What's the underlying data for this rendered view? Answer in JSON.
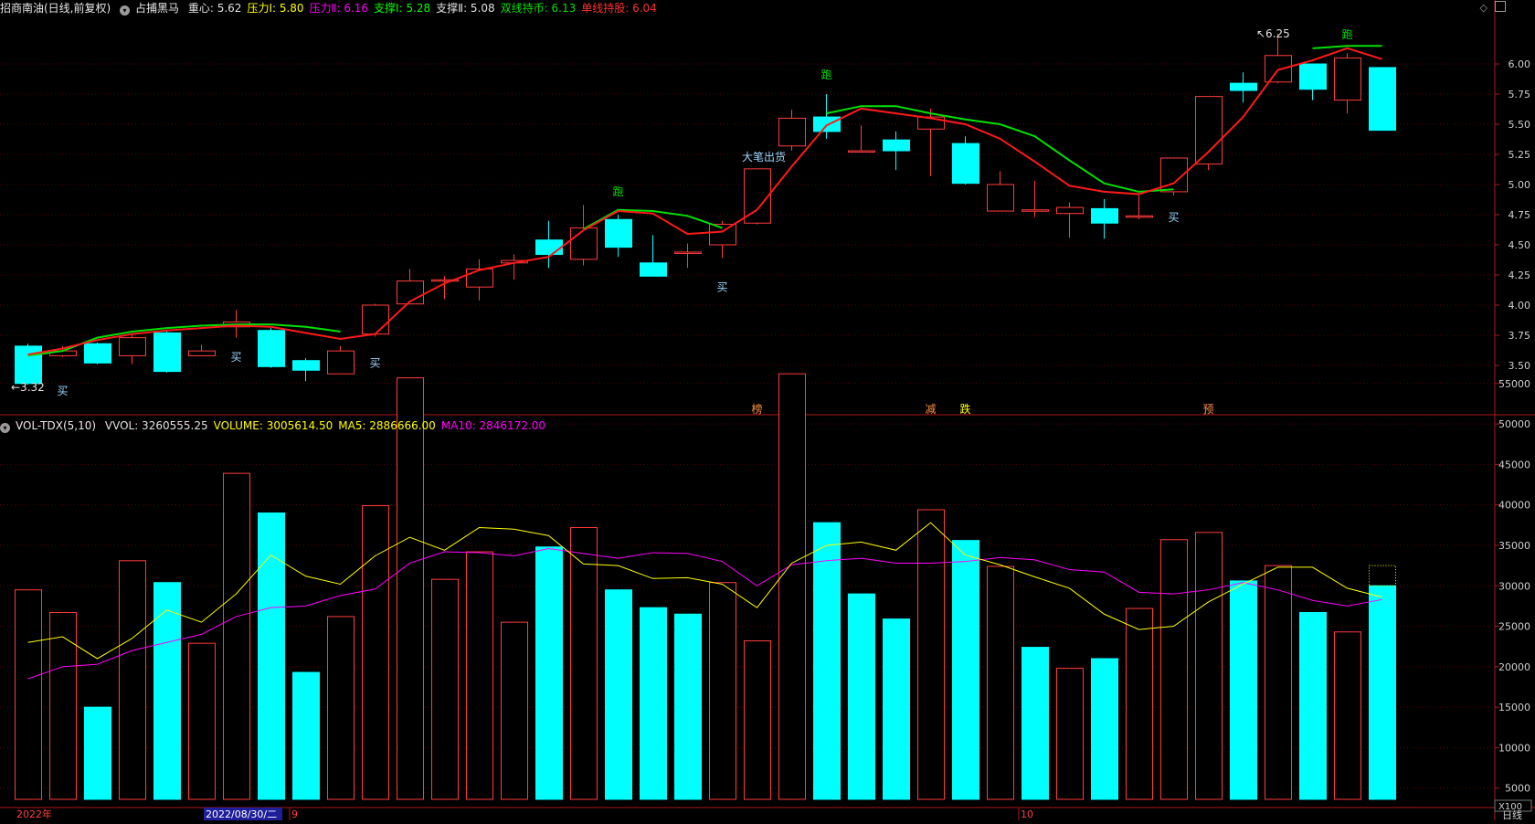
{
  "header": {
    "title": "招商南油(日线,前复权)",
    "indicator_name": "占捕黑马",
    "items": [
      {
        "label": "重心:",
        "value": "5.62",
        "color": "#e0e0e0"
      },
      {
        "label": "压力Ⅰ:",
        "value": "5.80",
        "color": "#ffff00"
      },
      {
        "label": "压力Ⅱ:",
        "value": "6.16",
        "color": "#ff00ff"
      },
      {
        "label": "支撑Ⅰ:",
        "value": "5.28",
        "color": "#00ff00"
      },
      {
        "label": "支撑Ⅱ:",
        "value": "5.08",
        "color": "#e0e0e0"
      },
      {
        "label": "双线持币:",
        "value": "6.13",
        "color": "#00e000"
      },
      {
        "label": "单线持股:",
        "value": "6.04",
        "color": "#ff3030"
      }
    ]
  },
  "vol_header": {
    "name": "VOL-TDX(5,10)",
    "items": [
      {
        "label": "VVOL:",
        "value": "3260555.25",
        "color": "#e0e0e0"
      },
      {
        "label": "VOLUME:",
        "value": "3005614.50",
        "color": "#ffff00"
      },
      {
        "label": "MA5:",
        "value": "2886666.00",
        "color": "#ffff00"
      },
      {
        "label": "MA10:",
        "value": "2846172.00",
        "color": "#ff00ff"
      }
    ]
  },
  "price_axis": [
    "6.00",
    "5.75",
    "5.50",
    "5.25",
    "5.00",
    "4.75",
    "4.50",
    "4.25",
    "4.00",
    "3.75",
    "3.50"
  ],
  "vol_axis": [
    "55000",
    "50000",
    "45000",
    "40000",
    "35000",
    "30000",
    "25000",
    "20000",
    "15000",
    "10000",
    "5000"
  ],
  "vol_unit": "X100",
  "period": "日线",
  "date_axis": {
    "year": "2022年",
    "cursor_date": "2022/08/30/二",
    "month9": "9",
    "month10": "10"
  },
  "annotations": {
    "low": "3.32",
    "high": "6.25",
    "sell_text": "大笔出货",
    "buy": "买",
    "run": "跑"
  },
  "bottom_markers": [
    {
      "idx": 21,
      "text": "榜",
      "color": "#ff9040"
    },
    {
      "idx": 26,
      "text": "减",
      "color": "#ff9040"
    },
    {
      "idx": 27,
      "text": "跌",
      "color": "#ffff00"
    },
    {
      "idx": 34,
      "text": "预",
      "color": "#ff9040"
    }
  ],
  "colors": {
    "up": "#ff3c3c",
    "down": "#00ffff",
    "grid": "#5a0000",
    "axis": "#b01818",
    "ma5": "#ffff00",
    "ma10": "#ff00ff",
    "redline": "#ff1a1a",
    "greenline": "#00e000"
  },
  "chart_data": {
    "type": "candlestick",
    "candles": [
      [
        3.66,
        3.35,
        3.68,
        3.34
      ],
      [
        3.58,
        3.62,
        3.66,
        3.57
      ],
      [
        3.68,
        3.52,
        3.69,
        3.51
      ],
      [
        3.58,
        3.73,
        3.77,
        3.51
      ],
      [
        3.77,
        3.45,
        3.79,
        3.44
      ],
      [
        3.58,
        3.62,
        3.67,
        3.58
      ],
      [
        3.82,
        3.86,
        3.96,
        3.73
      ],
      [
        3.79,
        3.49,
        3.81,
        3.48
      ],
      [
        3.54,
        3.46,
        3.56,
        3.37
      ],
      [
        3.43,
        3.62,
        3.66,
        3.43
      ],
      [
        3.76,
        4.0,
        4.01,
        3.74
      ],
      [
        4.01,
        4.2,
        4.3,
        4.01
      ],
      [
        4.2,
        4.21,
        4.24,
        4.05
      ],
      [
        4.15,
        4.3,
        4.38,
        4.04
      ],
      [
        4.35,
        4.37,
        4.42,
        4.21
      ],
      [
        4.54,
        4.42,
        4.7,
        4.31
      ],
      [
        4.38,
        4.64,
        4.83,
        4.33
      ],
      [
        4.71,
        4.48,
        4.75,
        4.4
      ],
      [
        4.35,
        4.24,
        4.58,
        4.24
      ],
      [
        4.44,
        4.44,
        4.51,
        4.31
      ],
      [
        4.5,
        4.67,
        4.7,
        4.39
      ],
      [
        4.68,
        5.13,
        5.13,
        4.67
      ],
      [
        5.32,
        5.55,
        5.62,
        5.28
      ],
      [
        5.56,
        5.44,
        5.75,
        5.38
      ],
      [
        5.28,
        5.28,
        5.49,
        5.28
      ],
      [
        5.37,
        5.28,
        5.44,
        5.12
      ],
      [
        5.46,
        5.56,
        5.63,
        5.07
      ],
      [
        5.34,
        5.01,
        5.4,
        5.0
      ],
      [
        4.78,
        5.0,
        5.11,
        4.78
      ],
      [
        4.79,
        4.79,
        5.03,
        4.73
      ],
      [
        4.76,
        4.81,
        4.85,
        4.56
      ],
      [
        4.8,
        4.68,
        4.88,
        4.55
      ],
      [
        4.74,
        4.74,
        4.91,
        4.71
      ],
      [
        4.94,
        5.22,
        5.22,
        4.91
      ],
      [
        5.17,
        5.73,
        5.73,
        5.12
      ],
      [
        5.84,
        5.78,
        5.93,
        5.68
      ],
      [
        5.85,
        6.07,
        6.25,
        5.84
      ],
      [
        6.0,
        5.79,
        6.0,
        5.7
      ],
      [
        5.7,
        6.05,
        6.09,
        5.59
      ],
      [
        5.97,
        5.45,
        5.97,
        5.45
      ]
    ],
    "red_line": [
      [
        0,
        3.59
      ],
      [
        1,
        3.64
      ],
      [
        2,
        3.71
      ],
      [
        3,
        3.76
      ],
      [
        4,
        3.79
      ],
      [
        5,
        3.81
      ],
      [
        6,
        3.83
      ],
      [
        7,
        3.82
      ],
      [
        8,
        3.77
      ],
      [
        9,
        3.72
      ],
      [
        10,
        3.76
      ],
      [
        11,
        4.03
      ],
      [
        12,
        4.18
      ],
      [
        13,
        4.29
      ],
      [
        14,
        4.35
      ],
      [
        15,
        4.4
      ],
      [
        16,
        4.62
      ],
      [
        17,
        4.78
      ],
      [
        18,
        4.76
      ],
      [
        19,
        4.59
      ],
      [
        20,
        4.61
      ],
      [
        21,
        4.79
      ],
      [
        22,
        5.15
      ],
      [
        23,
        5.49
      ],
      [
        24,
        5.63
      ],
      [
        25,
        5.59
      ],
      [
        26,
        5.55
      ],
      [
        27,
        5.5
      ],
      [
        28,
        5.38
      ],
      [
        29,
        5.19
      ],
      [
        30,
        4.99
      ],
      [
        31,
        4.94
      ],
      [
        32,
        4.92
      ],
      [
        33,
        5.01
      ],
      [
        34,
        5.27
      ],
      [
        35,
        5.56
      ],
      [
        36,
        5.95
      ],
      [
        37,
        6.03
      ],
      [
        38,
        6.13
      ],
      [
        39,
        6.04
      ]
    ],
    "green_line": [
      [
        0,
        3.58
      ],
      [
        1,
        3.62
      ],
      [
        2,
        3.73
      ],
      [
        3,
        3.78
      ],
      [
        4,
        3.81
      ],
      [
        5,
        3.83
      ],
      [
        6,
        3.84
      ],
      [
        7,
        3.84
      ],
      [
        8,
        3.82
      ],
      [
        9,
        3.78
      ],
      [
        16,
        4.63
      ],
      [
        17,
        4.79
      ],
      [
        18,
        4.78
      ],
      [
        19,
        4.74
      ],
      [
        20,
        4.64
      ],
      [
        23,
        5.59
      ],
      [
        24,
        5.65
      ],
      [
        25,
        5.65
      ],
      [
        26,
        5.59
      ],
      [
        27,
        5.54
      ],
      [
        28,
        5.5
      ],
      [
        29,
        5.4
      ],
      [
        30,
        5.2
      ],
      [
        31,
        5.01
      ],
      [
        32,
        4.94
      ],
      [
        33,
        4.96
      ],
      [
        37,
        6.13
      ],
      [
        38,
        6.15
      ],
      [
        39,
        6.15
      ]
    ],
    "volume": [
      29500,
      26700,
      15000,
      33100,
      30400,
      22900,
      43900,
      39000,
      19300,
      26200,
      39900,
      55700,
      30800,
      34200,
      25500,
      34800,
      37200,
      29500,
      27300,
      26500,
      30400,
      23200,
      56200,
      37800,
      29000,
      25900,
      39400,
      35600,
      32400,
      22400,
      19800,
      21000,
      27200,
      35700,
      36600,
      30600,
      32500,
      26700,
      24300,
      30000
    ],
    "vol_up": [
      1,
      1,
      0,
      1,
      0,
      1,
      1,
      0,
      0,
      1,
      1,
      1,
      1,
      1,
      1,
      0,
      1,
      0,
      0,
      0,
      1,
      1,
      1,
      0,
      0,
      0,
      1,
      0,
      1,
      0,
      1,
      0,
      1,
      1,
      1,
      0,
      1,
      0,
      1,
      0
    ],
    "ma5": [
      23000,
      23700,
      21000,
      23500,
      27000,
      25500,
      29000,
      33800,
      31200,
      30200,
      33700,
      36000,
      34400,
      37200,
      37000,
      36200,
      32700,
      32500,
      30900,
      31000,
      30200,
      27300,
      32800,
      35000,
      35400,
      34400,
      37800,
      33800,
      32600,
      31100,
      29700,
      26500,
      24600,
      25000,
      28000,
      30200,
      32300,
      32300,
      29700,
      28600
    ],
    "ma10": [
      18500,
      20000,
      20300,
      22000,
      23000,
      24000,
      26200,
      27300,
      27500,
      28800,
      29600,
      32800,
      34200,
      34100,
      33700,
      34600,
      34000,
      33400,
      34100,
      34000,
      33000,
      30000,
      32600,
      33100,
      33400,
      32800,
      32800,
      33000,
      33500,
      33200,
      32000,
      31700,
      29200,
      29000,
      29500,
      30400,
      29500,
      28200,
      27500,
      28300
    ]
  }
}
